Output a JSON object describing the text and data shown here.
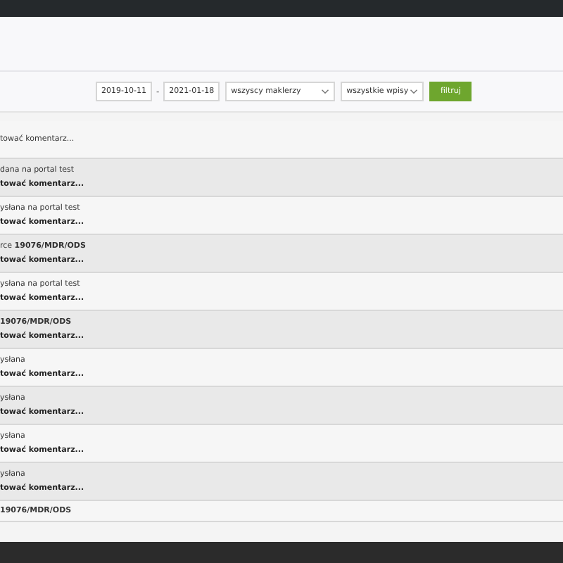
{
  "filters": {
    "date_from": "2019-10-11",
    "separator": "-",
    "date_to": "2021-01-18",
    "broker_select": "wszyscy maklerzy",
    "entries_select": "wszystkie wpisy",
    "button": "filtruj"
  },
  "entries": [
    {
      "lines": [
        "tować komentarz..."
      ]
    },
    {
      "lines": [
        "dana na portal test",
        "tować komentarz..."
      ]
    },
    {
      "lines": [
        "ysłana na portal test",
        "tować komentarz..."
      ]
    },
    {
      "lines": [
        "rce **19076/MDR/ODS**",
        "tować komentarz..."
      ]
    },
    {
      "lines": [
        "ysłana na portal test",
        "tować komentarz..."
      ]
    },
    {
      "lines": [
        "**19076/MDR/ODS**",
        "tować komentarz..."
      ]
    },
    {
      "lines": [
        "ysłana",
        "tować komentarz..."
      ]
    },
    {
      "lines": [
        "ysłana",
        "tować komentarz..."
      ]
    },
    {
      "lines": [
        "ysłana",
        "tować komentarz..."
      ]
    },
    {
      "lines": [
        "ysłana",
        "tować komentarz..."
      ]
    },
    {
      "lines": [
        "**19076/MDR/ODS**"
      ]
    }
  ]
}
